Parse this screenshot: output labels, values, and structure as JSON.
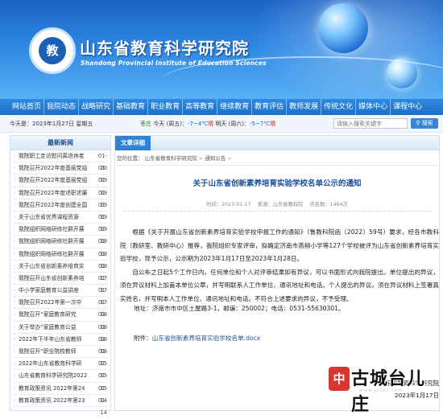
{
  "header": {
    "logo_text": "教",
    "title_cn": "山东省教育科学研究院",
    "title_en": "Shandong Provincial Institute of Education Sciences"
  },
  "nav": [
    "网站首页",
    "我院动态",
    "战略研究",
    "基础教育",
    "职业教育",
    "高等教育",
    "继续教育",
    "教育评估",
    "教师发展",
    "传统文化",
    "媒体中心",
    "课程中心"
  ],
  "infobar": {
    "date": "今天是：2023年1月27日 星期五",
    "city": "枣庄",
    "today_label": "今天 (周五)：",
    "today_temp": "-7~4℃",
    "today_cond": "晴",
    "tomorrow_label": "明天 (周六)：",
    "tomorrow_temp": "-5~7℃",
    "tomorrow_cond": "晴",
    "search_placeholder": "请输入搜索关键字",
    "search_button": "搜索"
  },
  "sidebar": {
    "title": "最新新闻",
    "items": [
      {
        "title": "我院职工走访慰问离退休老",
        "date": "01-20"
      },
      {
        "title": "我院召开2022年度基层党组",
        "date": "01-19"
      },
      {
        "title": "我院召开2022年度基层党组",
        "date": "01-19"
      },
      {
        "title": "我院召开2022年度述职述廉",
        "date": "01-19"
      },
      {
        "title": "我院召开2022年度创建全国",
        "date": "01-19"
      },
      {
        "title": "关于山东省优秀课程资源",
        "date": "01-19"
      },
      {
        "title": "我院组织网络研修社群开展",
        "date": "01-18"
      },
      {
        "title": "我院组织网络研修社群开展",
        "date": "01-18"
      },
      {
        "title": "我院组织网络研修社群开展",
        "date": "01-18"
      },
      {
        "title": "关于山东省创新素养培育实",
        "date": "01-17"
      },
      {
        "title": "我院召开山东省创新素养培",
        "date": "01-17"
      },
      {
        "title": "中小学家庭教育公益讲座",
        "date": "01-17"
      },
      {
        "title": "我院召开2022年第一次中",
        "date": "01-16"
      },
      {
        "title": "我院召开“家庭教育研究",
        "date": "01-16"
      },
      {
        "title": "关于举办“家庭教育公益",
        "date": "01-16"
      },
      {
        "title": "2022年下半年山东省教师",
        "date": "01-16"
      },
      {
        "title": "我院召开“职业院校教师",
        "date": "01-15"
      },
      {
        "title": "2022年山东省教育科学研",
        "date": "01-15"
      },
      {
        "title": "山东省教育科学研究院2022",
        "date": "01-15"
      },
      {
        "title": "教育政策资讯 2022年第24",
        "date": "01-14"
      },
      {
        "title": "教育政策资讯 2022年第23",
        "date": "01-14"
      }
    ]
  },
  "main": {
    "tab": "文章详细",
    "breadcrumb": [
      "您的位置：",
      "山东省教育科学研究院",
      ">",
      "通知公告",
      ">"
    ],
    "title": "关于山东省创新素养培育实验学校名单公示的通知",
    "meta": {
      "time": "时间：2023-01-17",
      "source": "来源：山东省教科院",
      "views": "点击数：1464次"
    },
    "para1": "根据《关于开展山东省创新素养培育实验学校申报工作的通知》（鲁教科院函〔2022〕59号）要求，经各市教科院（教研室、教研中心）推荐，我院组织专家评审，拟确定济南市燕柳小学等127个学校被评为山东省创新素养培育实验学校，现予公示，公示期为2023年1月17日至2023年1月28日。",
    "para2": "自公布之日起5个工作日内，任何单位和个人对评审结果如有异议，可以书面形式向我院提出。单位提出的异议，须在异议材料上加盖本单位公章，并写明联系人工作单位、通讯地址和电话。个人提出的异议，须在异议材料上签署真实姓名，并写明本人工作单位、通讯地址和电话。不符合上述要求的异议，不予受理。",
    "address": "地址：济南市市中区土屋路3-1，邮编：250002；电话：0531-55630301。",
    "attachment_label": "附件：",
    "attachment_file": "山东省创新素养培育实验学校名单.docx",
    "sign_org": "山东省教育科学研究院",
    "sign_date": "2023年1月17日"
  },
  "watermark": {
    "seal": "中国",
    "text": "古城台儿庄",
    "url": "www.gctez.com"
  }
}
